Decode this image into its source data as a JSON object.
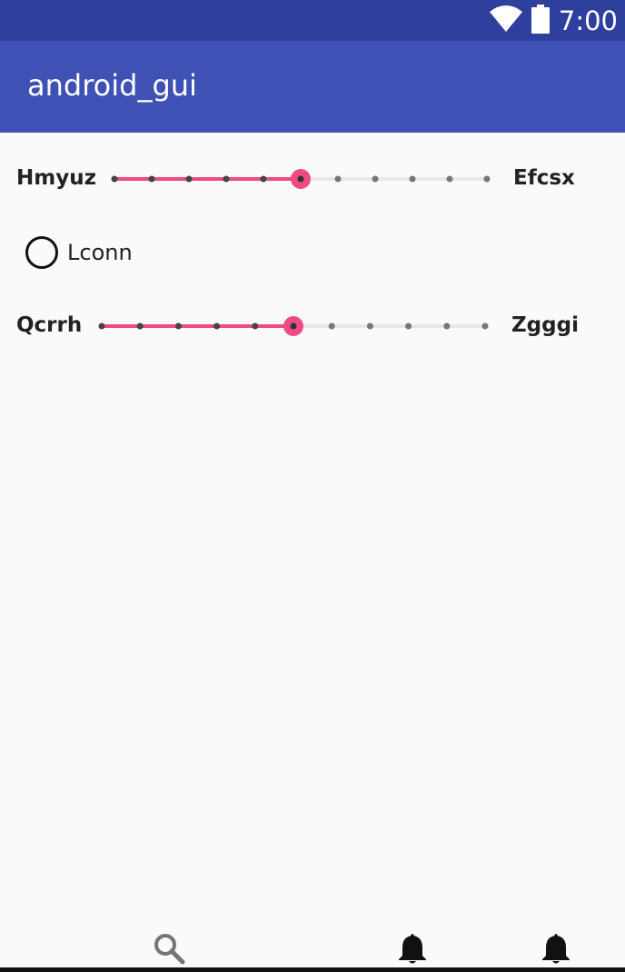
{
  "status_bar": {
    "time": "7:00",
    "icons": [
      "wifi-icon",
      "battery-icon"
    ]
  },
  "app_bar": {
    "title": "android_gui"
  },
  "sliders": [
    {
      "left_label": "Hmyuz",
      "right_label": "Efcsx",
      "steps": 10,
      "value": 5,
      "accent_color": "#ee4a85"
    },
    {
      "left_label": "Qcrrh",
      "right_label": "Zgggi",
      "steps": 10,
      "value": 5,
      "accent_color": "#ee4a85"
    }
  ],
  "radio": {
    "label": "Lconn",
    "checked": false
  },
  "bottom_nav": {
    "items": [
      {
        "icon": "search-icon"
      },
      {
        "icon": "bell-icon"
      },
      {
        "icon": "bell-icon"
      }
    ]
  },
  "colors": {
    "status_bar": "#2f3f9e",
    "app_bar": "#3f51b5",
    "accent": "#ee4a85",
    "background": "#fafafa"
  }
}
